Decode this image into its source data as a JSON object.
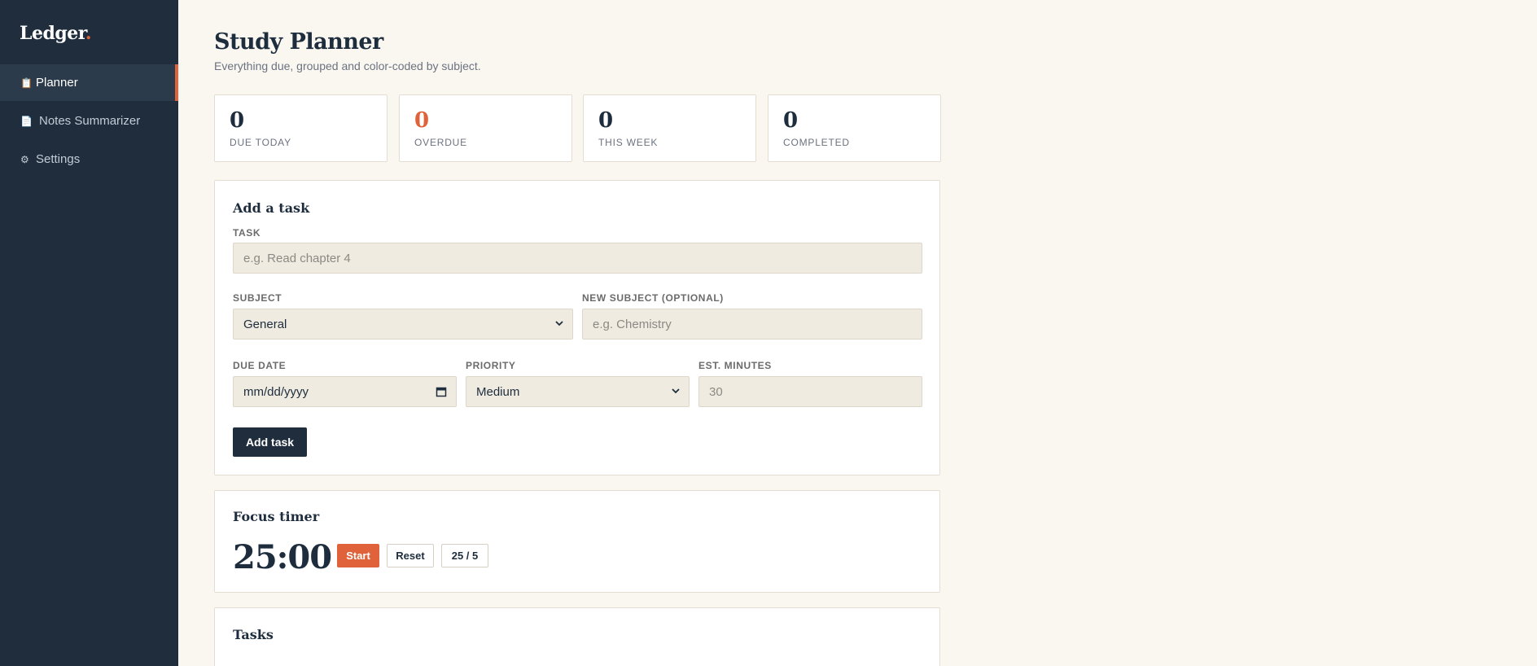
{
  "brand": {
    "name": "Ledger",
    "dot": "."
  },
  "nav": {
    "items": [
      {
        "label": "Planner",
        "icon": "clipboard-icon",
        "glyph": "📋",
        "active": true
      },
      {
        "label": "Notes Summarizer",
        "icon": "document-icon",
        "glyph": "📄",
        "active": false
      },
      {
        "label": "Settings",
        "icon": "gear-icon",
        "glyph": "⚙",
        "active": false
      }
    ]
  },
  "header": {
    "title": "Study Planner",
    "subtitle": "Everything due, grouped and color-coded by subject."
  },
  "stats": [
    {
      "value": "0",
      "label": "DUE TODAY"
    },
    {
      "value": "0",
      "label": "OVERDUE"
    },
    {
      "value": "0",
      "label": "THIS WEEK"
    },
    {
      "value": "0",
      "label": "COMPLETED"
    }
  ],
  "add_task": {
    "title": "Add a task",
    "task_label": "TASK",
    "task_placeholder": "e.g. Read chapter 4",
    "subject_label": "SUBJECT",
    "subject_value": "General",
    "new_subject_label": "NEW SUBJECT (OPTIONAL)",
    "new_subject_placeholder": "e.g. Chemistry",
    "due_label": "DUE DATE",
    "due_placeholder": "mm/dd/yyyy",
    "priority_label": "PRIORITY",
    "priority_value": "Medium",
    "minutes_label": "EST. MINUTES",
    "minutes_placeholder": "30",
    "submit_label": "Add task"
  },
  "focus_timer": {
    "title": "Focus timer",
    "time": "25:00",
    "start_label": "Start",
    "reset_label": "Reset",
    "mode_label": "25 / 5"
  },
  "tasks": {
    "title": "Tasks"
  },
  "colors": {
    "sidebar": "#1f2d3d",
    "accent": "#e0623a",
    "background": "#faf7f1",
    "field": "#f0ebe0"
  }
}
